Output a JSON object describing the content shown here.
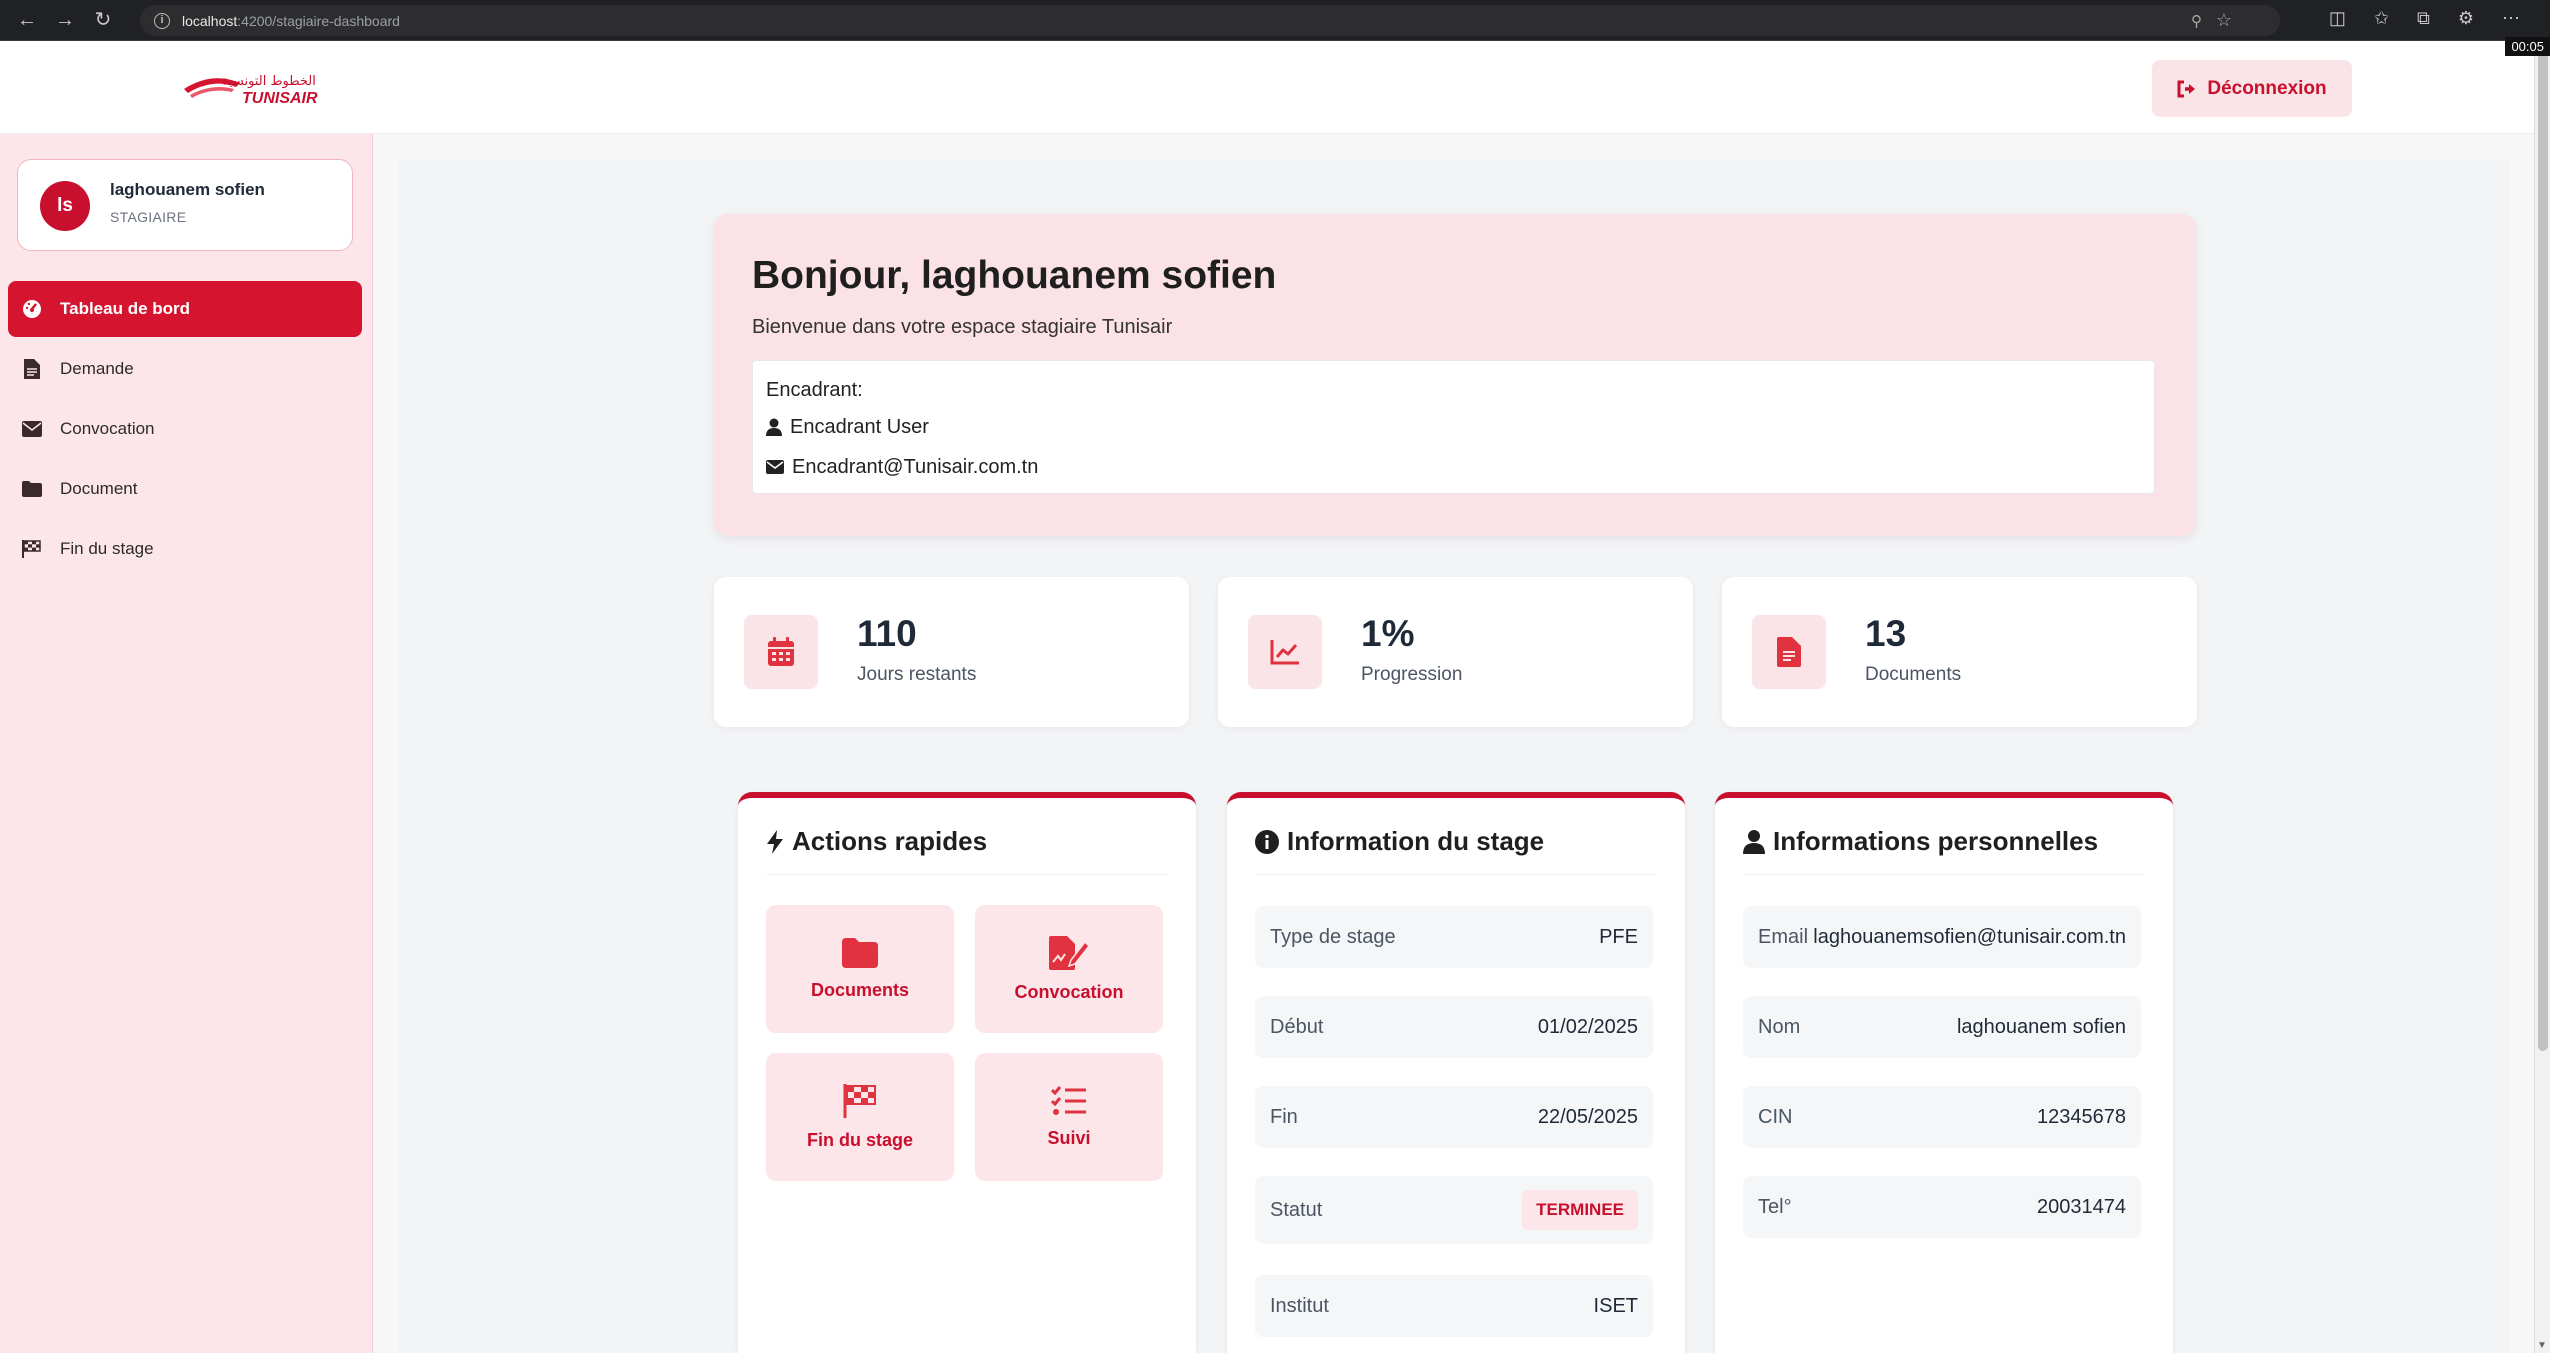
{
  "browser": {
    "url_host": "localhost",
    "url_path": ":4200/stagiaire-dashboard",
    "timer": "00:05"
  },
  "header": {
    "logo_text": "TUNISAIR",
    "logo_arabic": "الخطوط التونسية",
    "logout_label": "Déconnexion"
  },
  "user": {
    "initials": "ls",
    "name": "laghouanem sofien",
    "role": "STAGIAIRE"
  },
  "sidebar": {
    "items": [
      {
        "label": "Tableau de bord",
        "icon": "dashboard-icon",
        "active": true
      },
      {
        "label": "Demande",
        "icon": "file-icon"
      },
      {
        "label": "Convocation",
        "icon": "envelope-icon"
      },
      {
        "label": "Document",
        "icon": "folder-icon"
      },
      {
        "label": "Fin du stage",
        "icon": "checkered-flag-icon"
      }
    ]
  },
  "welcome": {
    "title": "Bonjour, laghouanem sofien",
    "subtitle": "Bienvenue dans votre espace stagiaire Tunisair",
    "encadrant_label": "Encadrant:",
    "encadrant_name": "Encadrant User",
    "encadrant_email": "Encadrant@Tunisair.com.tn"
  },
  "stats": [
    {
      "value": "110",
      "label": "Jours restants",
      "icon": "calendar-icon"
    },
    {
      "value": "1%",
      "label": "Progression",
      "icon": "chart-line-icon"
    },
    {
      "value": "13",
      "label": "Documents",
      "icon": "document-icon"
    }
  ],
  "quick_actions": {
    "title": "Actions rapides",
    "items": [
      {
        "label": "Documents",
        "icon": "folder-icon"
      },
      {
        "label": "Convocation",
        "icon": "signature-icon"
      },
      {
        "label": "Fin du stage",
        "icon": "checkered-flag-icon"
      },
      {
        "label": "Suivi",
        "icon": "task-list-icon"
      }
    ]
  },
  "stage_info": {
    "title": "Information du stage",
    "rows": [
      {
        "key": "Type de stage",
        "value": "PFE"
      },
      {
        "key": "Début",
        "value": "01/02/2025"
      },
      {
        "key": "Fin",
        "value": "22/05/2025"
      },
      {
        "key": "Statut",
        "value": "TERMINEE"
      },
      {
        "key": "Institut",
        "value": "ISET"
      }
    ]
  },
  "personal_info": {
    "title": "Informations personnelles",
    "rows": [
      {
        "key": "Email",
        "value": "laghouanemsofien@tunisair.com.tn"
      },
      {
        "key": "Nom",
        "value": "laghouanem sofien"
      },
      {
        "key": "CIN",
        "value": "12345678"
      },
      {
        "key": "Tel°",
        "value": "20031474"
      }
    ]
  },
  "colors": {
    "brand": "#c8102e",
    "sidebar_bg": "#fde6e9",
    "active_item": "#d5142f"
  }
}
